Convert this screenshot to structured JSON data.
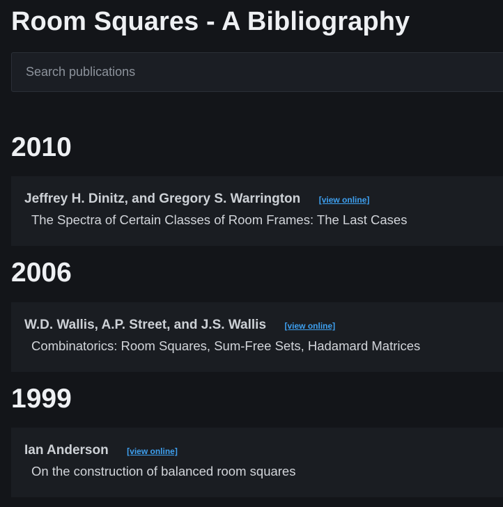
{
  "page": {
    "title": "Room Squares - A Bibliography"
  },
  "search": {
    "placeholder": "Search publications"
  },
  "groups": [
    {
      "year": "2010",
      "entries": [
        {
          "authors": "Jeffrey H. Dinitz, and Gregory S. Warrington",
          "link_label": "[view online]",
          "title": "The Spectra of Certain Classes of Room Frames: The Last Cases"
        }
      ]
    },
    {
      "year": "2006",
      "entries": [
        {
          "authors": "W.D. Wallis, A.P. Street, and J.S. Wallis",
          "link_label": "[view online]",
          "title": "Combinatorics: Room Squares, Sum-Free Sets, Hadamard Matrices"
        }
      ]
    },
    {
      "year": "1999",
      "entries": [
        {
          "authors": "Ian Anderson",
          "link_label": "[view online]",
          "title": "On the construction of balanced room squares"
        }
      ]
    }
  ],
  "colors": {
    "background": "#131519",
    "card": "#1a1d22",
    "link": "#3ea0f0"
  }
}
